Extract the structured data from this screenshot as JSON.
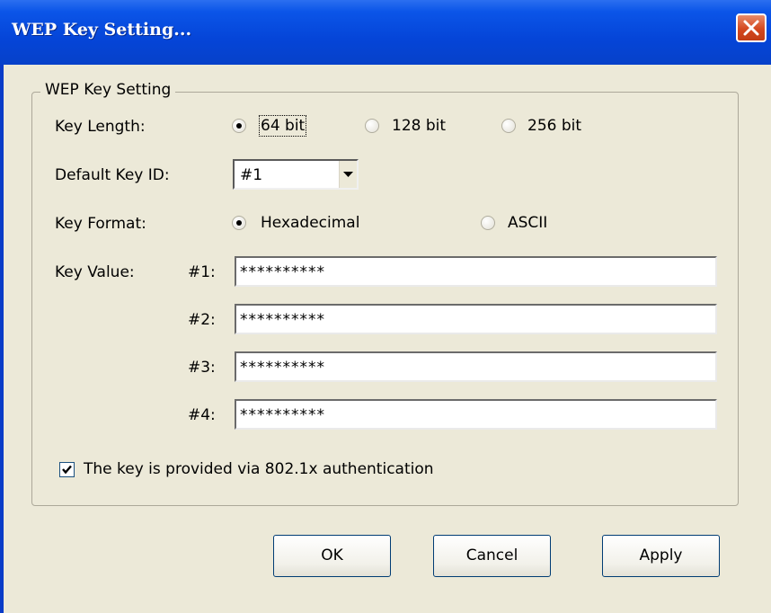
{
  "window": {
    "title": "WEP Key Setting..."
  },
  "group": {
    "legend": "WEP Key Setting"
  },
  "key_length": {
    "label": "Key Length:",
    "options": [
      "64 bit",
      "128 bit",
      "256 bit"
    ],
    "selected": "64 bit"
  },
  "default_key_id": {
    "label": "Default Key ID:",
    "value": "#1"
  },
  "key_format": {
    "label": "Key Format:",
    "options": [
      "Hexadecimal",
      "ASCII"
    ],
    "selected": "Hexadecimal"
  },
  "key_value": {
    "label": "Key Value:",
    "keys": [
      {
        "id": "#1:",
        "value": "**********"
      },
      {
        "id": "#2:",
        "value": "**********"
      },
      {
        "id": "#3:",
        "value": "**********"
      },
      {
        "id": "#4:",
        "value": "**********"
      }
    ]
  },
  "auth_checkbox": {
    "label": "The key is provided via 802.1x authentication",
    "checked": true
  },
  "buttons": {
    "ok": "OK",
    "cancel": "Cancel",
    "apply": "Apply"
  },
  "icons": {
    "close": "close-icon",
    "dropdown": "chevron-down-icon",
    "check": "checkmark-icon"
  },
  "colors": {
    "titlebar": "#0545d8",
    "close": "#d4481f",
    "dialog_bg": "#ece9d8",
    "button_border": "#003c74"
  }
}
